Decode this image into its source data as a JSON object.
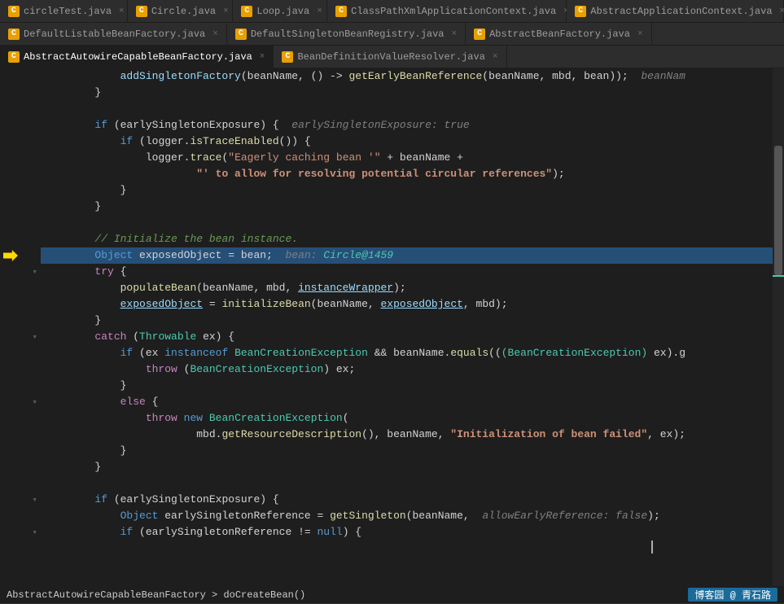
{
  "tabs_row1": [
    {
      "label": "circleTest.java",
      "active": false,
      "icon": "C"
    },
    {
      "label": "Circle.java",
      "active": false,
      "icon": "C"
    },
    {
      "label": "Loop.java",
      "active": false,
      "icon": "C"
    },
    {
      "label": "ClassPathXmlApplicationContext.java",
      "active": false,
      "icon": "C"
    },
    {
      "label": "AbstractApplicationContext.java",
      "active": false,
      "icon": "C"
    }
  ],
  "tabs_row2": [
    {
      "label": "DefaultListableBeanFactory.java",
      "active": false,
      "icon": "C"
    },
    {
      "label": "DefaultSingletonBeanRegistry.java",
      "active": false,
      "icon": "C"
    },
    {
      "label": "AbstractBeanFactory.java",
      "active": false,
      "icon": "C"
    }
  ],
  "tabs_row3": [
    {
      "label": "AbstractAutowireCapableBeanFactory.java",
      "active": true,
      "icon": "C"
    },
    {
      "label": "BeanDefinitionValueResolver.java",
      "active": false,
      "icon": "C"
    }
  ],
  "breadcrumb": {
    "text": "AbstractAutowireCapableBeanFactory > doCreateBean()"
  },
  "status_right": {
    "blog": "博客园 @ 青石路"
  },
  "code": {
    "lines": [
      {
        "num": "",
        "indent": 3,
        "content": "addSingletonFactory(beanName, () -> getEarlyBeanReference(beanName, mbd, bean));",
        "hint": " beanNam",
        "highlighted": false,
        "breakpoint": false,
        "debug": false,
        "foldable": false
      },
      {
        "num": "",
        "indent": 2,
        "content": "}",
        "highlighted": false,
        "breakpoint": false,
        "debug": false,
        "foldable": false
      },
      {
        "num": "",
        "indent": 2,
        "content": "",
        "highlighted": false,
        "breakpoint": false,
        "debug": false,
        "foldable": false
      },
      {
        "num": "",
        "indent": 2,
        "content": "if (earlySingletonExposure) {",
        "hint": " earlySingletonExposure: true",
        "highlighted": false,
        "breakpoint": false,
        "debug": false,
        "foldable": true
      },
      {
        "num": "",
        "indent": 3,
        "content": "if (logger.isTraceEnabled()) {",
        "highlighted": false,
        "breakpoint": false,
        "debug": false,
        "foldable": true
      },
      {
        "num": "",
        "indent": 4,
        "content": "logger.trace(\"Eagerly caching bean '\" + beanName +",
        "highlighted": false,
        "breakpoint": false,
        "debug": false,
        "foldable": false
      },
      {
        "num": "",
        "indent": 5,
        "content": "\"' to allow for resolving potential circular references\");",
        "highlighted": false,
        "breakpoint": false,
        "debug": false,
        "foldable": false
      },
      {
        "num": "",
        "indent": 3,
        "content": "}",
        "highlighted": false,
        "breakpoint": false,
        "debug": false,
        "foldable": false
      },
      {
        "num": "",
        "indent": 2,
        "content": "}",
        "highlighted": false,
        "breakpoint": false,
        "debug": false,
        "foldable": false
      },
      {
        "num": "",
        "indent": 1,
        "content": "",
        "highlighted": false,
        "breakpoint": false,
        "debug": false,
        "foldable": false
      },
      {
        "num": "",
        "indent": 2,
        "content": "// Initialize the bean instance.",
        "highlighted": false,
        "breakpoint": false,
        "debug": false,
        "foldable": false,
        "comment": true
      },
      {
        "num": "",
        "indent": 2,
        "content": "Object exposedObject = bean;",
        "hint": " bean: Circle@1459",
        "highlighted": true,
        "breakpoint": false,
        "debug": true,
        "foldable": false
      },
      {
        "num": "",
        "indent": 2,
        "content": "try {",
        "highlighted": false,
        "breakpoint": false,
        "debug": false,
        "foldable": true
      },
      {
        "num": "",
        "indent": 3,
        "content": "populateBean(beanName, mbd, instanceWrapper);",
        "highlighted": false,
        "breakpoint": false,
        "debug": false,
        "foldable": false
      },
      {
        "num": "",
        "indent": 3,
        "content": "exposedObject = initializeBean(beanName, exposedObject, mbd);",
        "highlighted": false,
        "breakpoint": false,
        "debug": false,
        "foldable": false
      },
      {
        "num": "",
        "indent": 2,
        "content": "}",
        "highlighted": false,
        "breakpoint": false,
        "debug": false,
        "foldable": false
      },
      {
        "num": "",
        "indent": 2,
        "content": "catch (Throwable ex) {",
        "highlighted": false,
        "breakpoint": false,
        "debug": false,
        "foldable": true
      },
      {
        "num": "",
        "indent": 3,
        "content": "if (ex instanceof BeanCreationException && beanName.equals(((BeanCreationException) ex).g",
        "highlighted": false,
        "breakpoint": false,
        "debug": false,
        "foldable": false
      },
      {
        "num": "",
        "indent": 4,
        "content": "throw (BeanCreationException) ex;",
        "highlighted": false,
        "breakpoint": false,
        "debug": false,
        "foldable": false
      },
      {
        "num": "",
        "indent": 3,
        "content": "}",
        "highlighted": false,
        "breakpoint": false,
        "debug": false,
        "foldable": false
      },
      {
        "num": "",
        "indent": 3,
        "content": "else {",
        "highlighted": false,
        "breakpoint": false,
        "debug": false,
        "foldable": true
      },
      {
        "num": "",
        "indent": 4,
        "content": "throw new BeanCreationException(",
        "highlighted": false,
        "breakpoint": false,
        "debug": false,
        "foldable": false
      },
      {
        "num": "",
        "indent": 5,
        "content": "mbd.getResourceDescription(), beanName, \"Initialization of bean failed\", ex);",
        "highlighted": false,
        "breakpoint": false,
        "debug": false,
        "foldable": false
      },
      {
        "num": "",
        "indent": 3,
        "content": "}",
        "highlighted": false,
        "breakpoint": false,
        "debug": false,
        "foldable": false
      },
      {
        "num": "",
        "indent": 2,
        "content": "}",
        "highlighted": false,
        "breakpoint": false,
        "debug": false,
        "foldable": false
      },
      {
        "num": "",
        "indent": 1,
        "content": "",
        "highlighted": false,
        "breakpoint": false,
        "debug": false,
        "foldable": false
      },
      {
        "num": "",
        "indent": 2,
        "content": "if (earlySingletonExposure) {",
        "highlighted": false,
        "breakpoint": false,
        "debug": false,
        "foldable": true
      },
      {
        "num": "",
        "indent": 3,
        "content": "Object earlySingletonReference = getSingleton(beanName,",
        "hint": " allowEarlyReference: false",
        "highlighted": false,
        "breakpoint": false,
        "debug": false,
        "foldable": false
      },
      {
        "num": "",
        "indent": 2,
        "content": "if (earlySingletonReference != null) {",
        "highlighted": false,
        "breakpoint": false,
        "debug": false,
        "foldable": true
      }
    ]
  }
}
